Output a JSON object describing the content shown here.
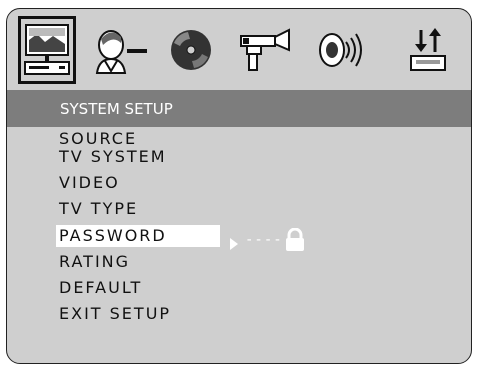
{
  "header": {
    "title": "SYSTEM SETUP"
  },
  "tabs": [
    {
      "icon": "monitor-icon",
      "selected": true
    },
    {
      "icon": "person-language-icon",
      "selected": false
    },
    {
      "icon": "disc-icon",
      "selected": false
    },
    {
      "icon": "video-camera-icon",
      "selected": false
    },
    {
      "icon": "speaker-icon",
      "selected": false
    },
    {
      "icon": "up-down-arrows-icon",
      "selected": false
    }
  ],
  "menu": {
    "items": [
      {
        "label": "SOURCE"
      },
      {
        "label": "TV SYSTEM"
      },
      {
        "label": "VIDEO"
      },
      {
        "label": "TV TYPE"
      },
      {
        "label": "PASSWORD",
        "selected": true
      },
      {
        "label": "RATING"
      },
      {
        "label": "DEFAULT"
      },
      {
        "label": "EXIT SETUP"
      }
    ]
  },
  "password_value": "----",
  "colors": {
    "panel": "#cfcfcf",
    "header": "#7d7d7d",
    "highlight": "#ffffff",
    "text": "#111111"
  }
}
